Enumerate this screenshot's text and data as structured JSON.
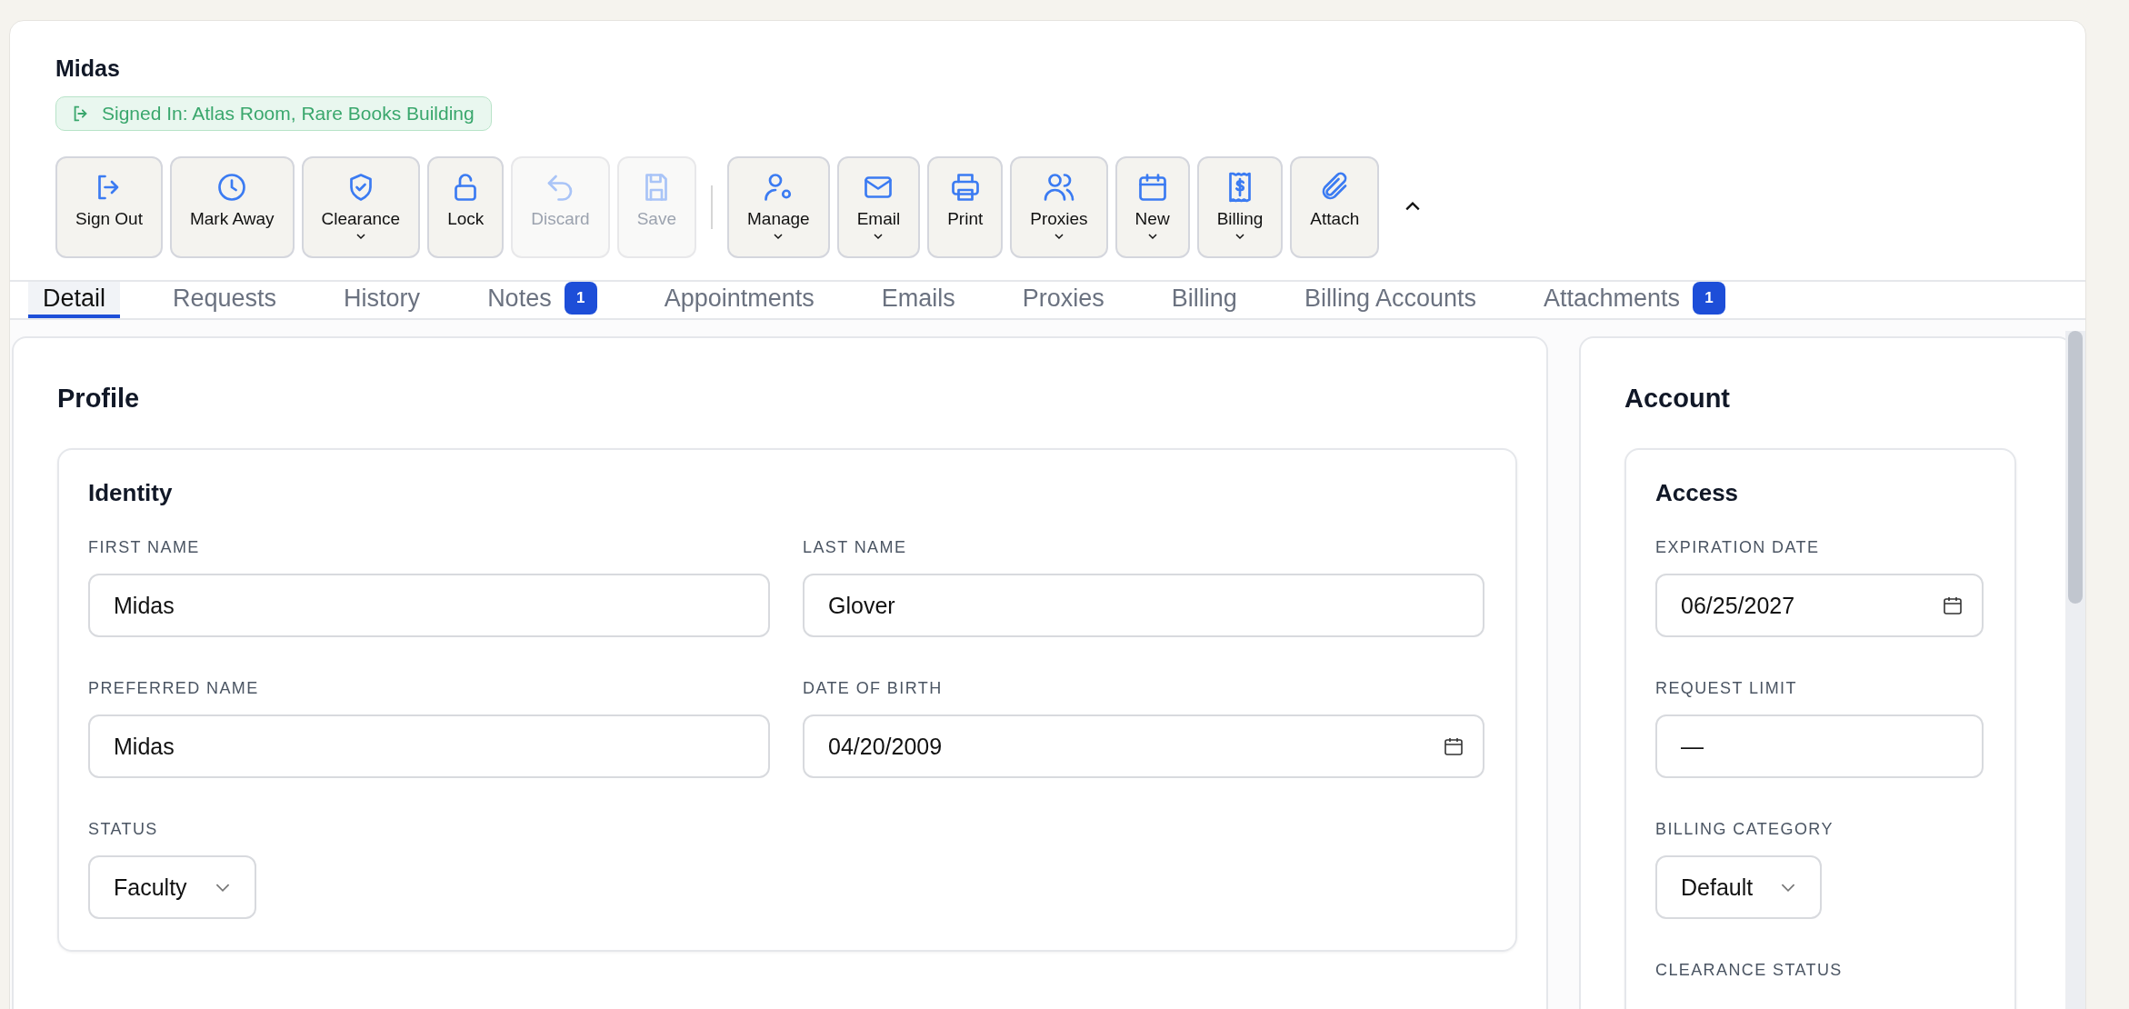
{
  "patron": {
    "name": "Midas",
    "status_badge": "Signed In: Atlas Room, Rare Books Building"
  },
  "toolbar": {
    "groups": [
      [
        {
          "label": "Sign Out",
          "dropdown": false,
          "disabled": false
        },
        {
          "label": "Mark Away",
          "dropdown": false,
          "disabled": false
        },
        {
          "label": "Clearance",
          "dropdown": true,
          "disabled": false
        },
        {
          "label": "Lock",
          "dropdown": false,
          "disabled": false
        },
        {
          "label": "Discard",
          "dropdown": false,
          "disabled": true
        },
        {
          "label": "Save",
          "dropdown": false,
          "disabled": true
        }
      ],
      [
        {
          "label": "Manage",
          "dropdown": true,
          "disabled": false
        },
        {
          "label": "Email",
          "dropdown": true,
          "disabled": false
        },
        {
          "label": "Print",
          "dropdown": false,
          "disabled": false
        },
        {
          "label": "Proxies",
          "dropdown": true,
          "disabled": false
        },
        {
          "label": "New",
          "dropdown": true,
          "disabled": false
        },
        {
          "label": "Billing",
          "dropdown": true,
          "disabled": false
        },
        {
          "label": "Attach",
          "dropdown": false,
          "disabled": false
        }
      ]
    ]
  },
  "tabs": [
    {
      "label": "Detail",
      "selected": true
    },
    {
      "label": "Requests",
      "selected": false
    },
    {
      "label": "History",
      "selected": false
    },
    {
      "label": "Notes",
      "selected": false,
      "badge": "1"
    },
    {
      "label": "Appointments",
      "selected": false
    },
    {
      "label": "Emails",
      "selected": false
    },
    {
      "label": "Proxies",
      "selected": false
    },
    {
      "label": "Billing",
      "selected": false
    },
    {
      "label": "Billing Accounts",
      "selected": false
    },
    {
      "label": "Attachments",
      "selected": false,
      "badge": "1"
    }
  ],
  "profile": {
    "title": "Profile",
    "card": {
      "title": "Identity",
      "fields": [
        {
          "label": "FIRST NAME",
          "value": "Midas",
          "kind": "text"
        },
        {
          "label": "LAST NAME",
          "value": "Glover",
          "kind": "text"
        },
        {
          "label": "PREFERRED NAME",
          "value": "Midas",
          "kind": "text"
        },
        {
          "label": "DATE OF BIRTH",
          "value": "04/20/2009",
          "kind": "date"
        },
        {
          "label": "STATUS",
          "value": "Faculty",
          "kind": "select"
        }
      ]
    }
  },
  "account": {
    "title": "Account",
    "card": {
      "title": "Access",
      "fields": [
        {
          "label": "EXPIRATION DATE",
          "value": "06/25/2027",
          "kind": "date"
        },
        {
          "label": "REQUEST LIMIT",
          "value": "—",
          "kind": "text"
        },
        {
          "label": "BILLING CATEGORY",
          "value": "Default",
          "kind": "select"
        },
        {
          "label": "CLEARANCE STATUS",
          "kind": "label"
        }
      ]
    }
  }
}
